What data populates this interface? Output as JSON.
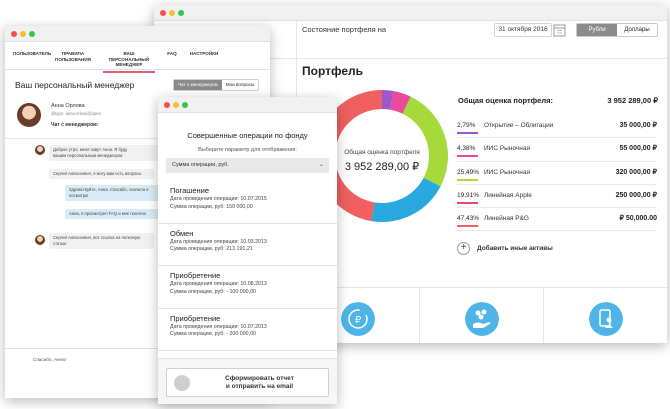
{
  "portfolio": {
    "state_label": "Состояние портфеля на",
    "date": "31 октября 2016",
    "currency_options": [
      "Рубли",
      "Доллары"
    ],
    "currency_selected": "Рубли",
    "title": "Портфель",
    "donut_label": "Общая оценка портфеля",
    "donut_value": "3 952 289,00 ₽",
    "total_label": "Общая оценка портфеля:",
    "total_value": "3 952 289,00 ₽",
    "assets": [
      {
        "pct": "2,79%",
        "name": "Открытие – Облигации",
        "value": "35 000,00 ₽",
        "share": 2.79,
        "color": "#9b59d0"
      },
      {
        "pct": "4,38%",
        "name": "ИИС Рыночная",
        "value": "55 000,00 ₽",
        "share": 4.38,
        "color": "#e94b9a"
      },
      {
        "pct": "25,49%",
        "name": "ИИС Рыночная",
        "value": "320 000,00 ₽",
        "share": 25.49,
        "color": "#a6d93a"
      },
      {
        "pct": "19,91%",
        "name": "Линейная Apple",
        "value": "250 000,00 ₽",
        "share": 19.91,
        "color": "#e94b6a"
      },
      {
        "pct": "47,43%",
        "name": "Линейная P&G",
        "value": "₽ 50,000.00",
        "share": 47.43,
        "color": "#f06060"
      }
    ],
    "donut_colors": [
      "#9b59d0",
      "#e94b9a",
      "#a6d93a",
      "#29a8e0",
      "#f06060"
    ],
    "donut_shares": [
      2.79,
      4.38,
      25.49,
      19.91,
      47.43
    ],
    "add_assets": "Добавить иные активы",
    "accent": "#4fb5e8"
  },
  "manager": {
    "nav": [
      "ПОЛЬЗОВАТЕЛЬ",
      "ПРАВИЛА ПОЛЬЗОВАНИЯ",
      "ВАШ ПЕРСОНАЛЬНЫЙ МЕНЕДЖЕР",
      "FAQ",
      "НАСТРОЙКИ"
    ],
    "nav_active": "ВАШ ПЕРСОНАЛЬНЫЙ МЕНЕДЖЕР",
    "title": "Ваш персональный менеджер",
    "tabs": [
      "Чат с менеджером",
      "Мои вопросы"
    ],
    "tab_selected": "Чат с менеджером",
    "manager_name": "Анна Орлова",
    "manager_email": "@type: anna.orlova@open",
    "chat_label": "Чат с менеджером:",
    "messages": [
      "Доброе утро, меня зовут Анна. Я буду",
      "вашим персональным менеджером.",
      "Сергей Алексеевич, я могу вам есть вопросы",
      "Здравствуйте, Анна. Спасибо, сначала я посмотрю",
      "Анна, я просмотрел FAQ и мне понятно",
      "Сергей Алексеевич, вот ссылка на полезную статью"
    ],
    "input_text": "Спасибо, Анна!"
  },
  "operations": {
    "title": "Совершенные операции по фонду",
    "param_label": "Выберите параметр для отображения:",
    "select_value": "Сумма операции, руб.",
    "items": [
      {
        "name": "Погашение",
        "date": "Дата проведения операции: 10.07.2015",
        "sum": "Сумма операции, руб: 150 000,00"
      },
      {
        "name": "Обмен",
        "date": "Дата проведения операции: 10.03.2013",
        "sum": "Сумма операции, руб: 213 191,21"
      },
      {
        "name": "Приобретение",
        "date": "Дата проведения операции: 10.08.2013",
        "sum": "Сумма операции, руб: - 100 000,00"
      },
      {
        "name": "Приобретение",
        "date": "Дата проведения операции: 10.07.2013",
        "sum": "Сумма операции, руб: - 200 000,00"
      }
    ],
    "report_button": "Сформировать отчет и отправить на email"
  }
}
